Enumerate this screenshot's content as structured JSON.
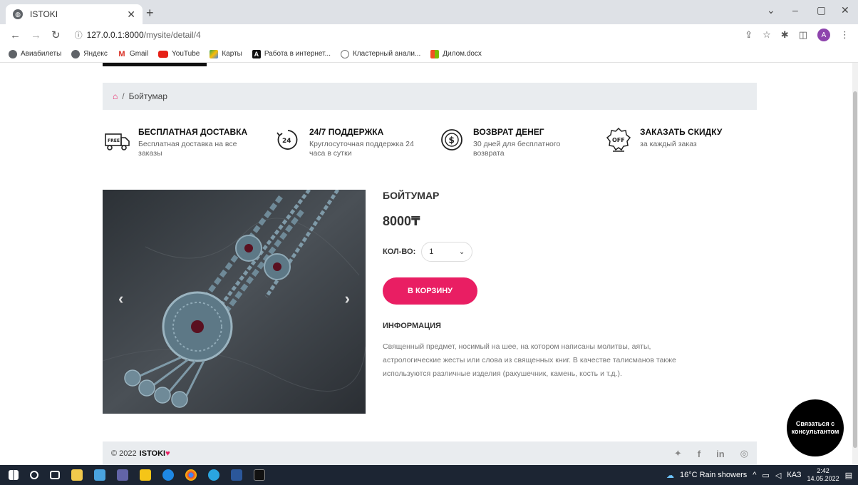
{
  "browser": {
    "tab_title": "ISTOKI",
    "url_host": "127.0.0.1:8000",
    "url_path": "/mysite/detail/4",
    "profile_initial": "A",
    "bookmarks": [
      "Авиабилеты",
      "Яндекс",
      "Gmail",
      "YouTube",
      "Карты",
      "Работа в интернет...",
      "Кластерный анали...",
      "Дилом.docx"
    ]
  },
  "breadcrumb": {
    "current": "Бойтумар"
  },
  "features": [
    {
      "title": "БЕСПЛАТНАЯ ДОСТАВКА",
      "desc": "Бесплатная доставка на все заказы"
    },
    {
      "title": "24/7 ПОДДЕРЖКА",
      "desc": "Круглосуточная поддержка 24 часа в сутки"
    },
    {
      "title": "ВОЗВРАТ ДЕНЕГ",
      "desc": "30 дней для бесплатного возврата"
    },
    {
      "title": "ЗАКАЗАТЬ СКИДКУ",
      "desc": "за каждый заказ"
    }
  ],
  "product": {
    "title": "БОЙТУМАР",
    "price": "8000₸",
    "qty_label": "КОЛ-ВО:",
    "qty_value": "1",
    "cart_button": "В КОРЗИНУ",
    "info_heading": "ИНФОРМАЦИЯ",
    "info_text": "Священный предмет, носимый на шее, на котором написаны молитвы, аяты, астрологические жесты или слова из священных книг. В качестве талисманов также используются различные изделия (ракушечник, камень, кость и т.д.)."
  },
  "footer": {
    "copyright": "© 2022",
    "brand": "ISTOKI"
  },
  "consult_button": "Связаться с консультантом",
  "taskbar": {
    "weather": "16°C Rain showers",
    "lang": "КАЗ",
    "time": "2:42",
    "date": "14.05.2022"
  },
  "colors": {
    "accent": "#e91e63",
    "light_bar": "#e9ecef"
  }
}
